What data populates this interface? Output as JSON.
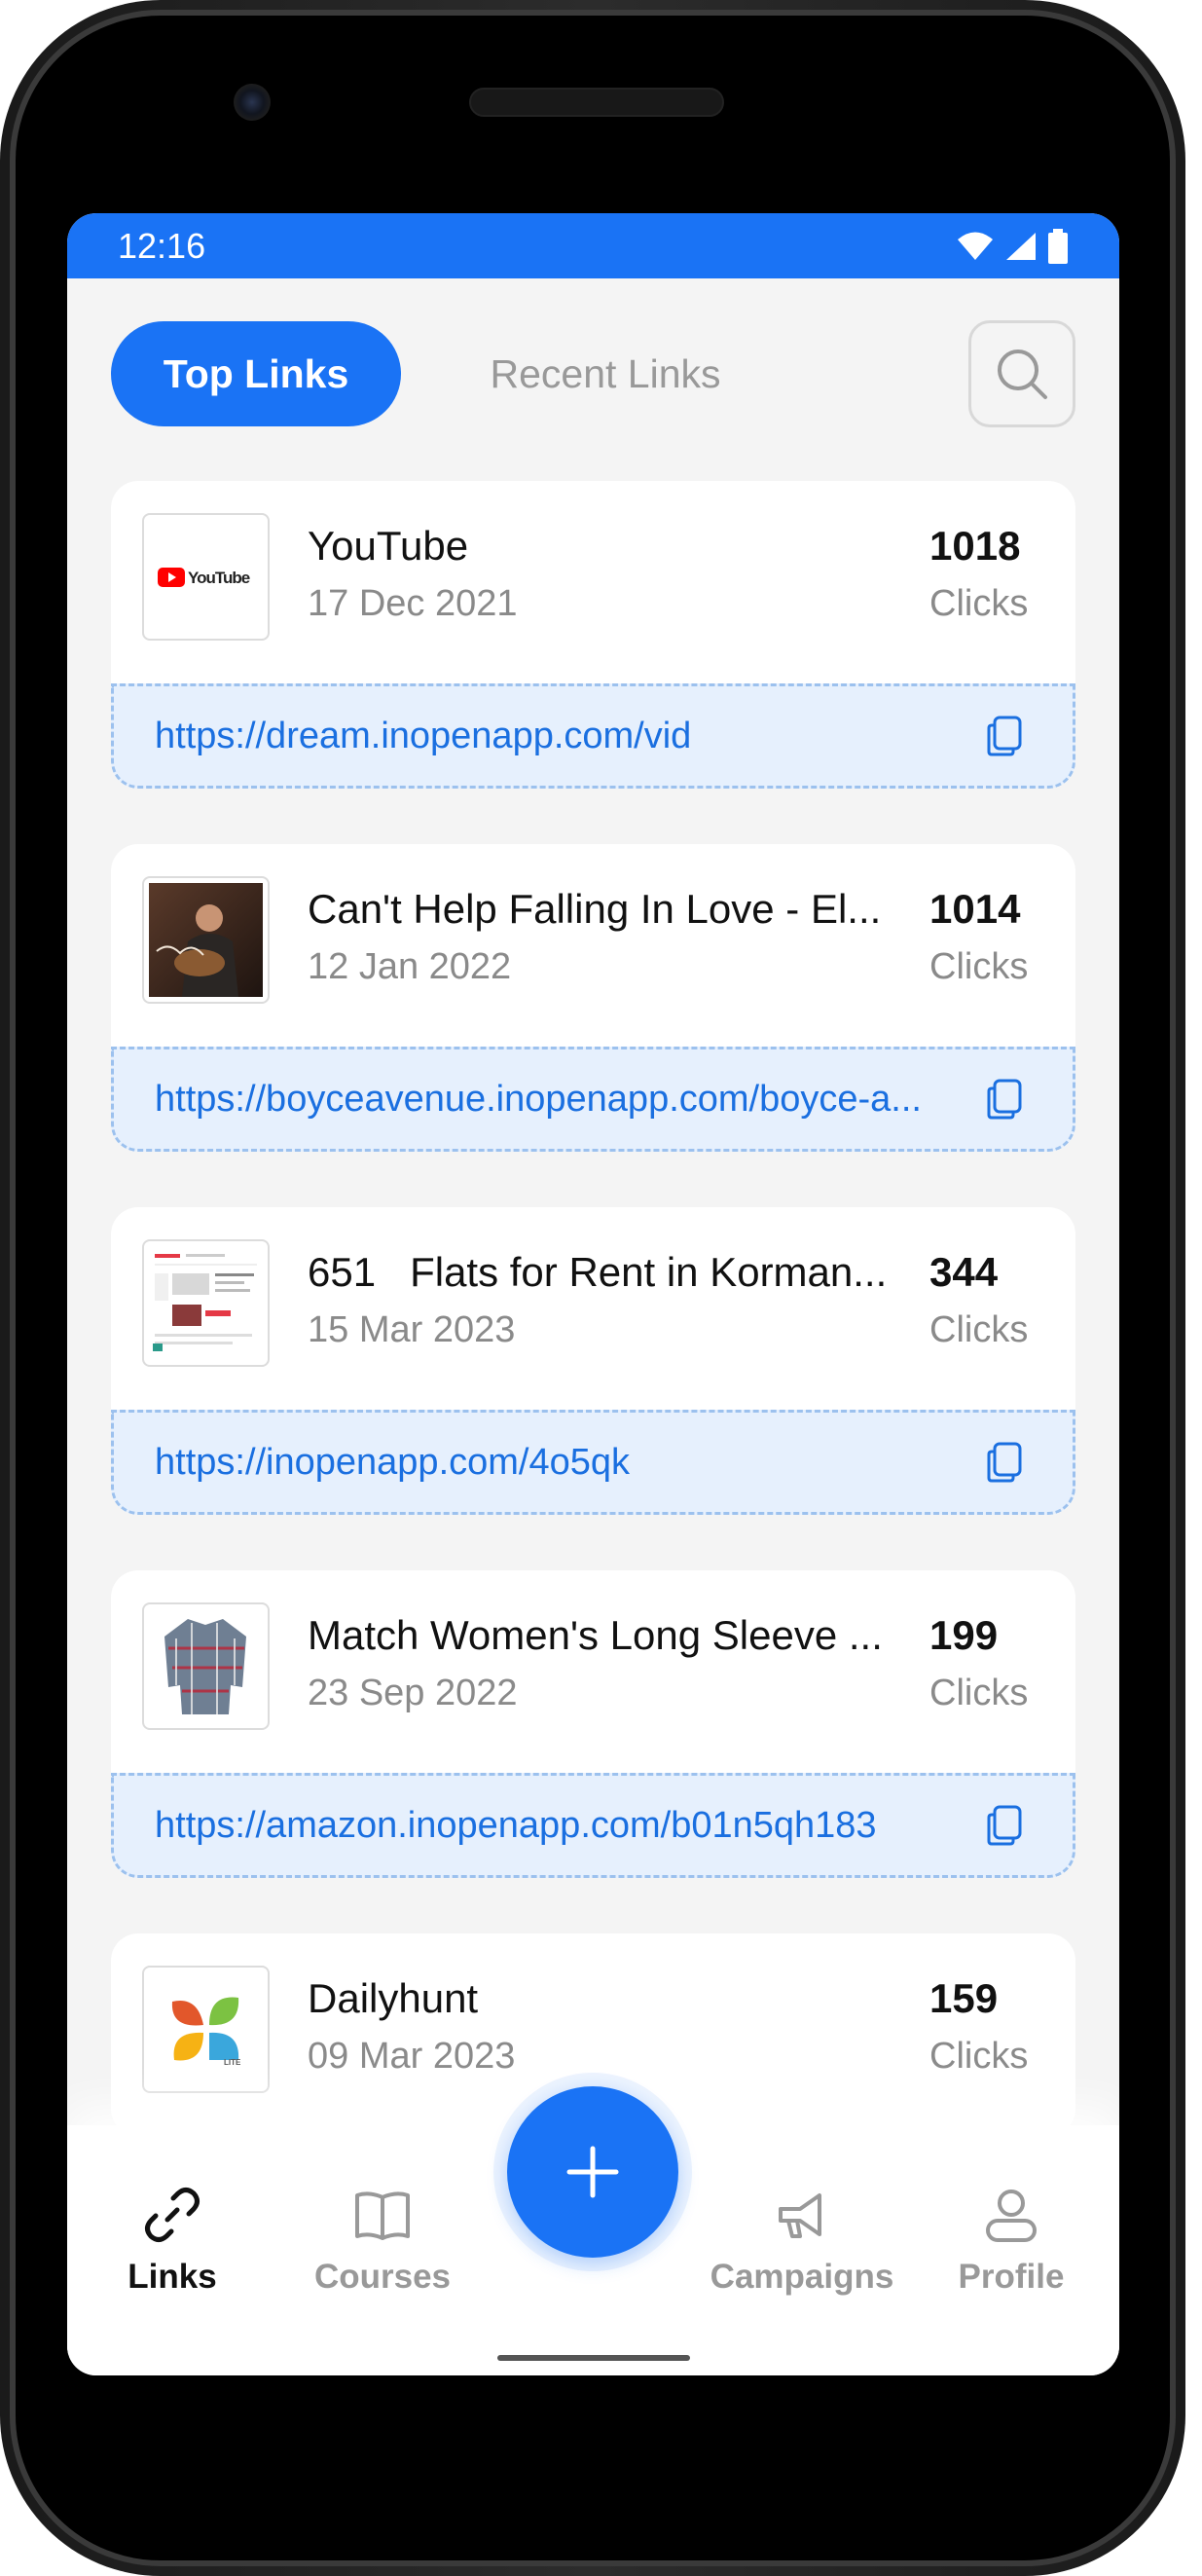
{
  "status_bar": {
    "time": "12:16"
  },
  "tabs": {
    "top_links": "Top Links",
    "recent_links": "Recent Links"
  },
  "links": [
    {
      "title": "YouTube",
      "date": "17 Dec 2021",
      "clicks": "1018",
      "clicks_label": "Clicks",
      "url": "https://dream.inopenapp.com/vid",
      "thumb": "youtube-logo"
    },
    {
      "title": "Can't Help Falling In Love - El...",
      "date": "12 Jan 2022",
      "clicks": "1014",
      "clicks_label": "Clicks",
      "url": "https://boyceavenue.inopenapp.com/boyce-a...",
      "thumb": "video-thumbnail"
    },
    {
      "title": "651   Flats for Rent in Korman...",
      "date": "15 Mar 2023",
      "clicks": "344",
      "clicks_label": "Clicks",
      "url": "https://inopenapp.com/4o5qk",
      "thumb": "website-screenshot"
    },
    {
      "title": "Match Women's Long Sleeve ...",
      "date": "23 Sep 2022",
      "clicks": "199",
      "clicks_label": "Clicks",
      "url": "https://amazon.inopenapp.com/b01n5qh183",
      "thumb": "shirt-product"
    },
    {
      "title": "Dailyhunt",
      "date": "09 Mar 2023",
      "clicks": "159",
      "clicks_label": "Clicks",
      "url": "",
      "thumb": "dailyhunt-logo"
    }
  ],
  "youtube_logo_text": "YouTube",
  "dailyhunt_logo_text": "LITE",
  "bottom_nav": {
    "links": "Links",
    "courses": "Courses",
    "campaigns": "Campaigns",
    "profile": "Profile"
  },
  "colors": {
    "accent": "#1a73f5",
    "url_bg": "#e6f0fd",
    "url_text": "#1a6fe0"
  }
}
